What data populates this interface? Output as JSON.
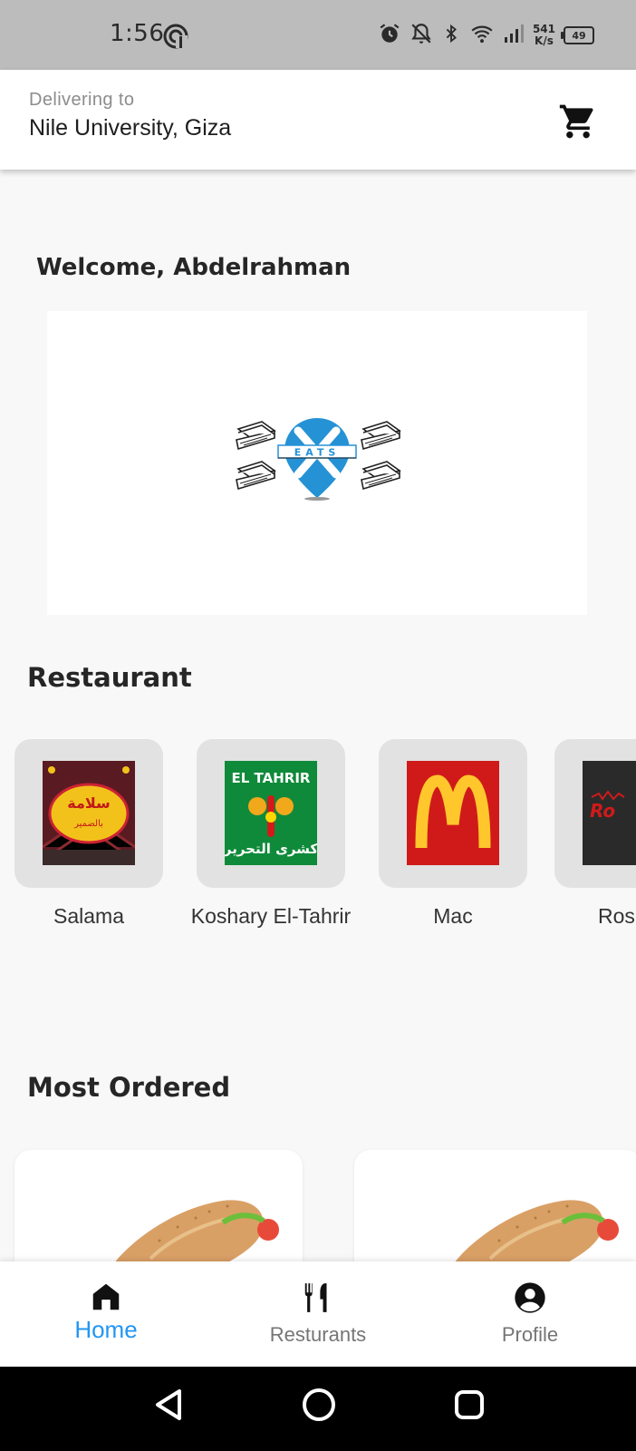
{
  "status_bar": {
    "time": "1:56",
    "net_speed_value": "541",
    "net_speed_unit": "K/s",
    "battery": "49",
    "icons": [
      "alarm-icon",
      "notifications-off-icon",
      "bluetooth-icon",
      "wifi-icon",
      "signal-icon",
      "battery-icon"
    ]
  },
  "header": {
    "delivering_label": "Delivering to",
    "location": "Nile University, Giza",
    "cart_icon": "cart-icon"
  },
  "welcome": "Welcome, Abdelrahman",
  "banner": {
    "logo_text": "EATS",
    "logo_letter": "X",
    "brand_color": "#2592d5"
  },
  "restaurants": {
    "title": "Restaurant",
    "items": [
      {
        "name": "Salama"
      },
      {
        "name": "Koshary El-Tahrir",
        "logo_top": "EL TAHRIR",
        "logo_bottom": "كشرى التحرير"
      },
      {
        "name": "Mac"
      },
      {
        "name": "Ros"
      }
    ]
  },
  "most_ordered": {
    "title": "Most Ordered"
  },
  "bottom_nav": {
    "items": [
      {
        "label": "Home",
        "icon": "home-icon",
        "active": true
      },
      {
        "label": "Resturants",
        "icon": "restaurant-icon",
        "active": false
      },
      {
        "label": "Profile",
        "icon": "account-icon",
        "active": false
      }
    ],
    "active_color": "#2196f3",
    "inactive_color": "#757575"
  },
  "system_nav": [
    "back-icon",
    "home-circle-icon",
    "recents-icon"
  ]
}
